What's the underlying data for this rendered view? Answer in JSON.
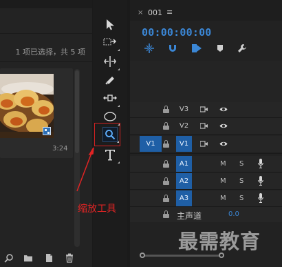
{
  "project_panel": {
    "selection_status": "1 项已选择，共 5 项",
    "clip_duration": "3:24"
  },
  "tools": {
    "items": [
      "selection-tool",
      "track-select-tool",
      "ripple-edit-tool",
      "razor-tool",
      "slip-tool",
      "pen-tool",
      "zoom-tool",
      "type-tool"
    ],
    "active": "zoom-tool"
  },
  "annotation": {
    "label": "缩放工具",
    "color": "#e02424"
  },
  "timeline": {
    "close_glyph": "×",
    "sequence_name": "001",
    "menu_glyph": "≡",
    "timecode": "00:00:00:00",
    "video_tracks": [
      {
        "name": "V3",
        "source": ""
      },
      {
        "name": "V2",
        "source": ""
      },
      {
        "name": "V1",
        "source": "V1"
      }
    ],
    "audio_tracks": [
      {
        "name": "A1",
        "m": "M",
        "s": "S"
      },
      {
        "name": "A2",
        "m": "M",
        "s": "S"
      },
      {
        "name": "A3",
        "m": "M",
        "s": "S"
      }
    ],
    "master": {
      "label": "主声道",
      "value": "0.0"
    }
  },
  "watermark": "最需教育",
  "colors": {
    "accent_blue": "#3b87d6",
    "track_target": "#1f5fa6",
    "annotation_red": "#d42222"
  }
}
